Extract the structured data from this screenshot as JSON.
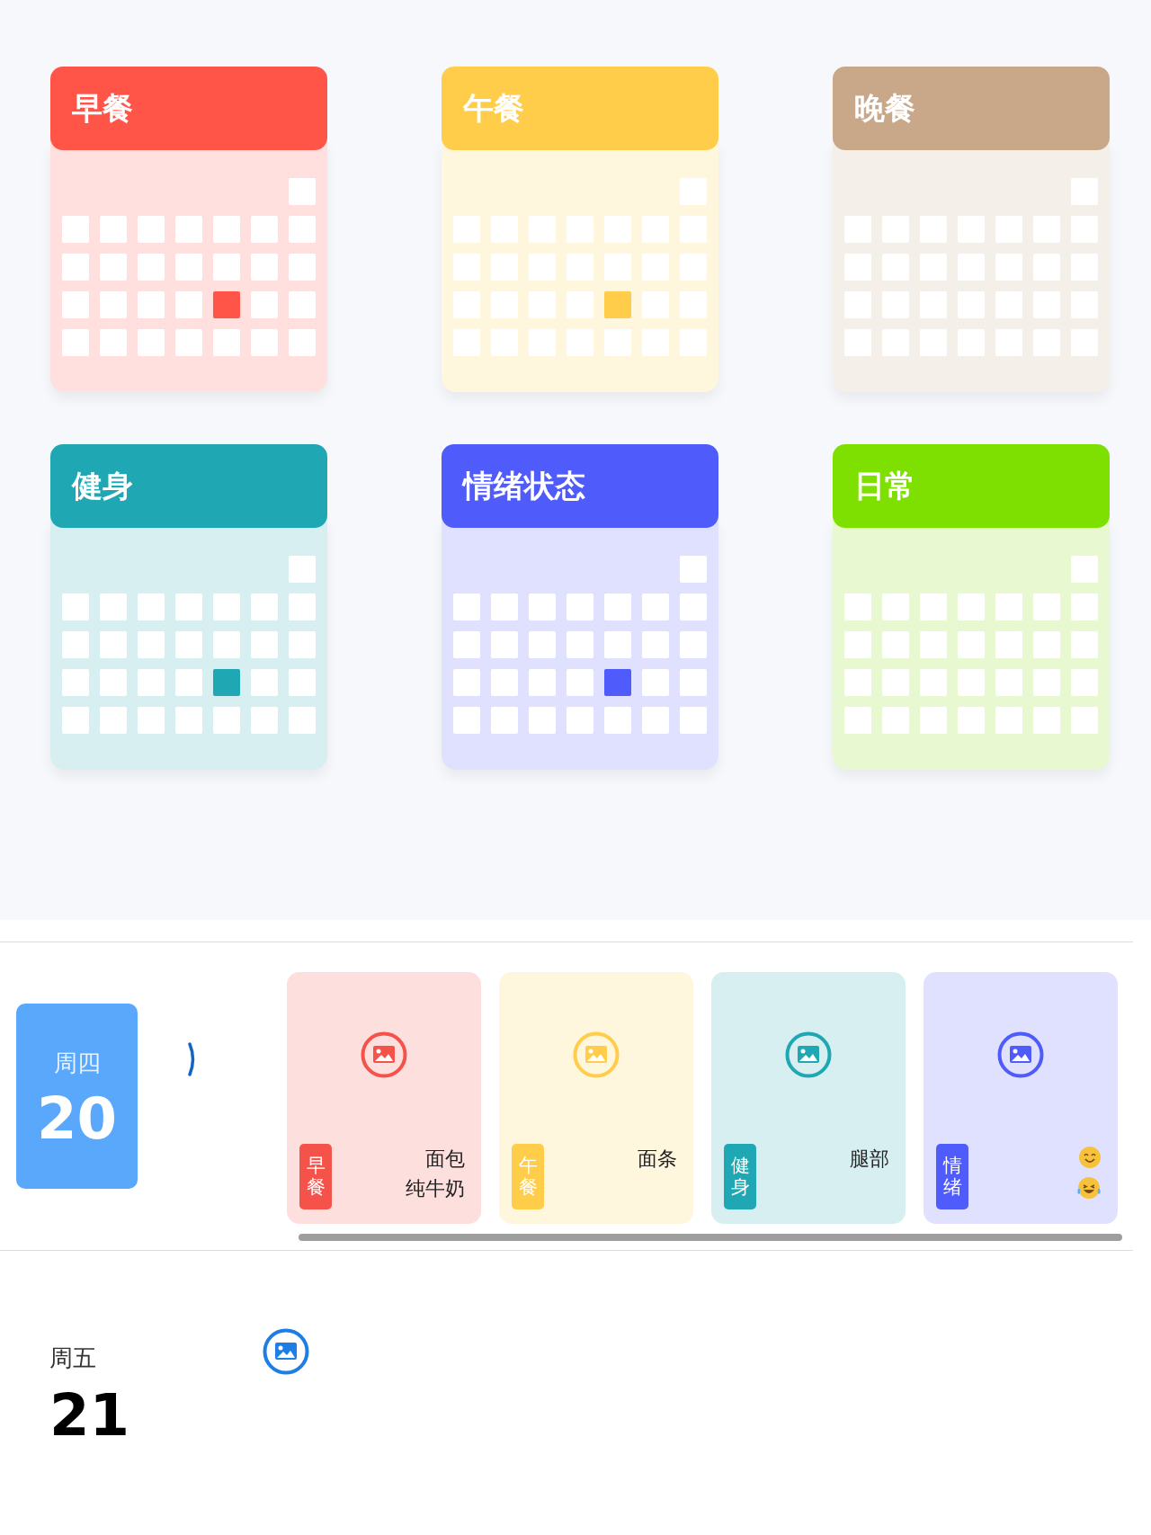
{
  "calendars": [
    {
      "title": "早餐",
      "color": "#ff5549",
      "has_entry_today": true
    },
    {
      "title": "午餐",
      "color": "#ffcd4a",
      "has_entry_today": true
    },
    {
      "title": "晚餐",
      "color": "#c9a789",
      "has_entry_today": false
    },
    {
      "title": "健身",
      "color": "#1fa8b3",
      "has_entry_today": true
    },
    {
      "title": "情绪状态",
      "color": "#4f5bfb",
      "has_entry_today": true
    },
    {
      "title": "日常",
      "color": "#7ee000",
      "has_entry_today": false
    }
  ],
  "days": [
    {
      "weekday": "周四",
      "date": "20",
      "selected": true,
      "refreshing": true,
      "entries": [
        {
          "tag": "早餐",
          "color": "#f5524a",
          "lines": [
            "面包",
            "纯牛奶"
          ]
        },
        {
          "tag": "午餐",
          "color": "#ffcd4a",
          "lines": [
            "面条"
          ]
        },
        {
          "tag": "健身",
          "color": "#1fa8b3",
          "lines": [
            "腿部"
          ]
        },
        {
          "tag": "情绪",
          "color": "#4f5bfb",
          "moods": [
            {
              "kind": "smile"
            },
            {
              "kind": "laugh"
            }
          ]
        }
      ]
    },
    {
      "weekday": "周五",
      "date": "21",
      "selected": false
    }
  ]
}
